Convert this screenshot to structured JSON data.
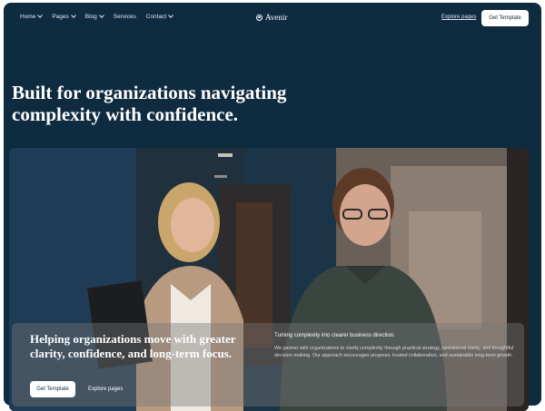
{
  "nav": {
    "items": [
      {
        "label": "Home",
        "has_dropdown": true
      },
      {
        "label": "Pages",
        "has_dropdown": true
      },
      {
        "label": "Blog",
        "has_dropdown": true
      },
      {
        "label": "Services",
        "has_dropdown": false
      },
      {
        "label": "Contact",
        "has_dropdown": true
      }
    ],
    "brand": "Avenir",
    "secondary_link": "Explore pages",
    "cta_label": "Get Template"
  },
  "hero": {
    "title": "Built for organizations navigating complexity with confidence."
  },
  "overlay": {
    "heading": "Helping organizations move with greater clarity, confidence, and long-term focus.",
    "primary_button": "Get Template",
    "secondary_button": "Explore pages",
    "subheading": "Turning complexity into clearer business direction.",
    "body": "We partner with organizations to clarify complexity through practical strategy, operational clarity, and thoughtful decision-making. Our approach encourages progress, trusted collaboration, and sustainable long-term growth."
  },
  "colors": {
    "background": "#0f2b40",
    "text": "#ffffff",
    "button_bg": "#ffffff",
    "button_text": "#0f2b40"
  }
}
